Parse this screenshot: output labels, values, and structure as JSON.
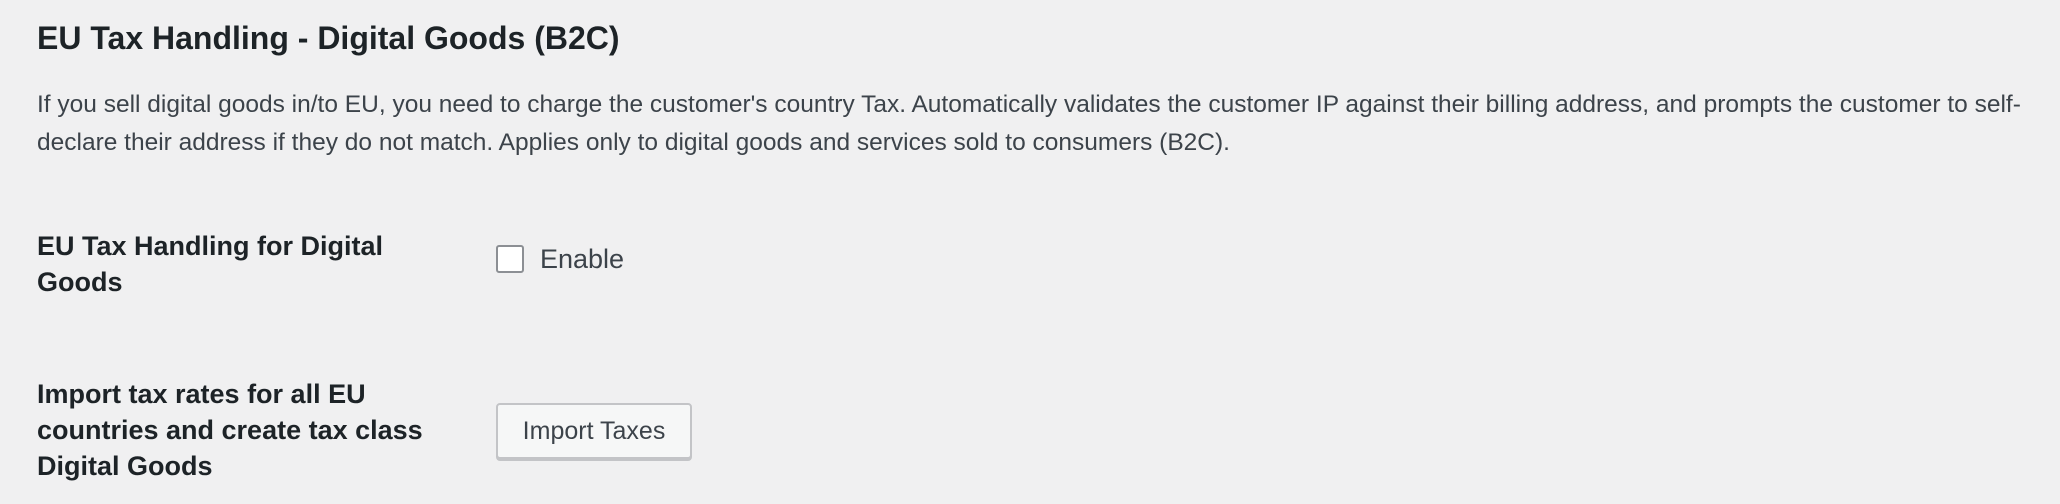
{
  "section": {
    "title": "EU Tax Handling - Digital Goods (B2C)",
    "description": "If you sell digital goods in/to EU, you need to charge the customer's country Tax. Automatically validates the customer IP against their billing address, and prompts the customer to self-declare their address if they do not match. Applies only to digital goods and services sold to consumers (B2C)."
  },
  "fields": {
    "eu_tax_handling": {
      "label": "EU Tax Handling for Digital Goods",
      "checkbox_label": "Enable",
      "checked": false
    },
    "import_tax_rates": {
      "label": "Import tax rates for all EU countries and create tax class Digital Goods",
      "button_label": "Import Taxes"
    }
  }
}
